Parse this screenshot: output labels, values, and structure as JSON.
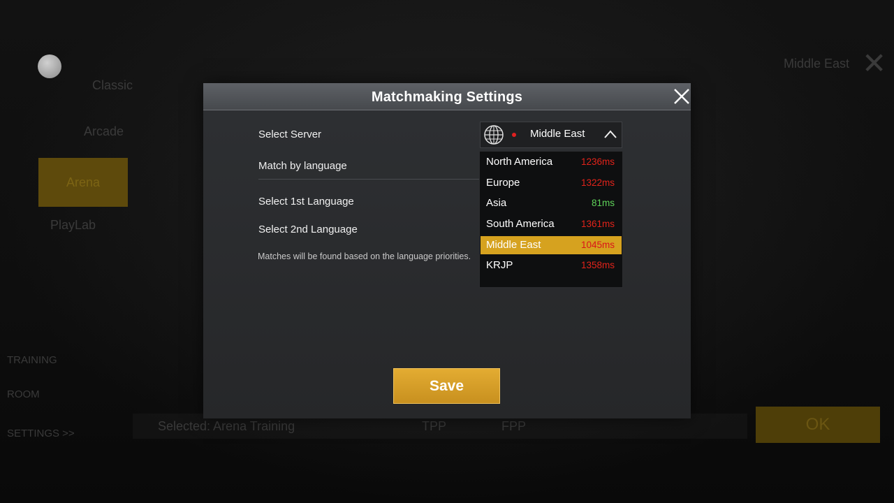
{
  "dialog": {
    "title": "Matchmaking Settings",
    "select_server_label": "Select Server",
    "match_by_language_label": "Match by language",
    "select_1st_language_label": "Select 1st Language",
    "select_2nd_language_label": "Select 2nd Language",
    "hint": "Matches will be found based on the language priorities.",
    "save_label": "Save"
  },
  "server": {
    "selected": "Middle East",
    "options": [
      {
        "name": "North America",
        "ping": "1236ms",
        "status": "red"
      },
      {
        "name": "Europe",
        "ping": "1322ms",
        "status": "red"
      },
      {
        "name": "Asia",
        "ping": "81ms",
        "status": "green"
      },
      {
        "name": "South America",
        "ping": "1361ms",
        "status": "red"
      },
      {
        "name": "Middle East",
        "ping": "1045ms",
        "status": "red",
        "selected": true
      },
      {
        "name": "KRJP",
        "ping": "1358ms",
        "status": "red"
      }
    ]
  },
  "background": {
    "classic": "Classic",
    "arcade": "Arcade",
    "arena": "Arena",
    "playlab": "PlayLab",
    "training": "TRAINING",
    "room": "ROOM",
    "settings": "SETTINGS >>",
    "selected_mode": "Selected: Arena Training",
    "tpp": "TPP",
    "fpp": "FPP",
    "region": "Middle East",
    "ok": "OK"
  },
  "colors": {
    "accent": "#d6a21f",
    "ping_bad": "#e2231a",
    "ping_good": "#5fd45a"
  },
  "icons": {
    "close": "close-icon",
    "globe": "globe-icon",
    "chevron": "chevron-up-icon"
  }
}
